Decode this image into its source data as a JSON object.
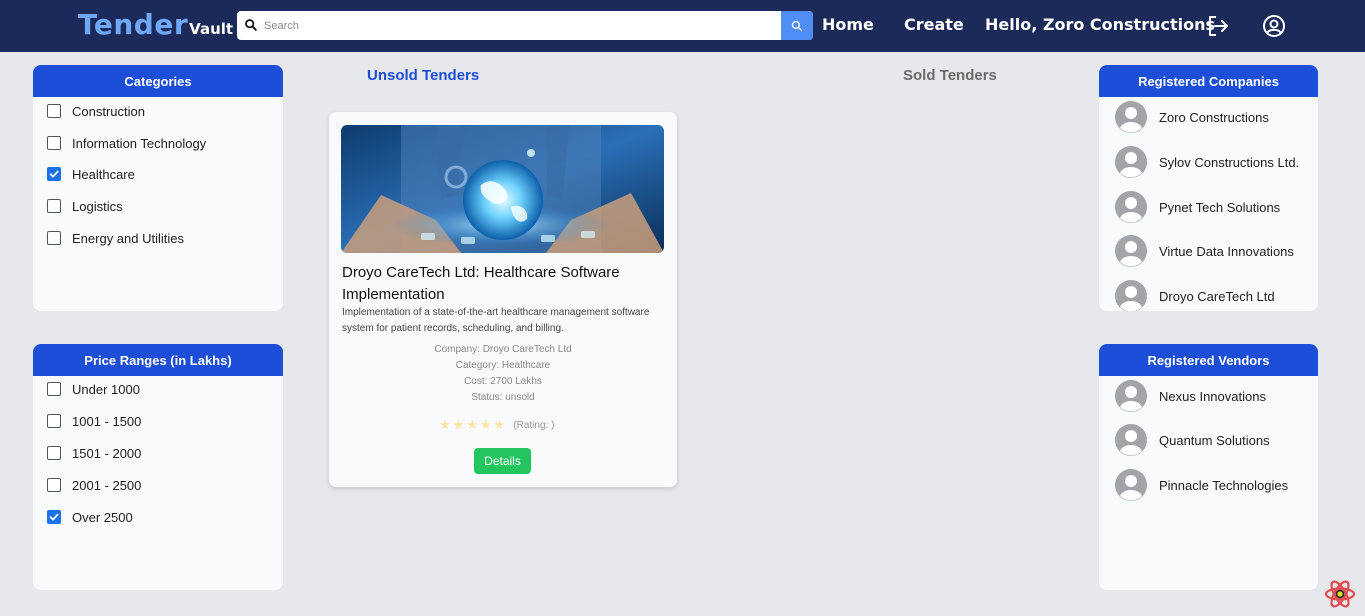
{
  "brand": {
    "main": "Tender",
    "sub": "Vault"
  },
  "search": {
    "placeholder": "Search"
  },
  "nav": {
    "home": "Home",
    "create": "Create",
    "greeting": "Hello, Zoro Constructions"
  },
  "categories": {
    "title": "Categories",
    "items": [
      {
        "label": "Construction",
        "checked": false
      },
      {
        "label": "Information Technology",
        "checked": false
      },
      {
        "label": "Healthcare",
        "checked": true
      },
      {
        "label": "Logistics",
        "checked": false
      },
      {
        "label": "Energy and Utilities",
        "checked": false
      }
    ]
  },
  "price_ranges": {
    "title": "Price Ranges (in Lakhs)",
    "items": [
      {
        "label": "Under 1000",
        "checked": false
      },
      {
        "label": "1001 - 1500",
        "checked": false
      },
      {
        "label": "1501 - 2000",
        "checked": false
      },
      {
        "label": "2001 - 2500",
        "checked": false
      },
      {
        "label": "Over 2500",
        "checked": true
      }
    ]
  },
  "tabs": {
    "unsold": "Unsold Tenders",
    "sold": "Sold Tenders"
  },
  "tender_card": {
    "title": "Droyo CareTech Ltd: Healthcare Software Implementation",
    "description": "Implementation of a state-of-the-art healthcare management software system for patient records, scheduling, and billing.",
    "company": "Company: Droyo CareTech Ltd",
    "category": "Category: Healthcare",
    "cost": "Cost: 2700 Lakhs",
    "status": "Status: unsold",
    "rating_label": "(Rating: )",
    "stars": 5,
    "details_label": "Details"
  },
  "registered_companies": {
    "title": "Registered Companies",
    "items": [
      "Zoro Constructions",
      "Sylov Constructions Ltd.",
      "Pynet Tech Solutions",
      "Virtue Data Innovations",
      "Droyo CareTech Ltd"
    ]
  },
  "registered_vendors": {
    "title": "Registered Vendors",
    "items": [
      "Nexus Innovations",
      "Quantum Solutions",
      "Pinnacle Technologies"
    ]
  },
  "colors": {
    "header_bg": "#1b2a59",
    "accent_blue": "#1d4ed8",
    "brand_blue": "#6ea8f7",
    "details_green": "#22c55e",
    "checkbox_blue": "#1a73e8"
  },
  "icons": {
    "search": "search-icon",
    "logout": "logout-icon",
    "profile": "user-circle-icon",
    "avatar": "avatar-icon",
    "star": "star-icon",
    "react": "react-logo-icon"
  }
}
